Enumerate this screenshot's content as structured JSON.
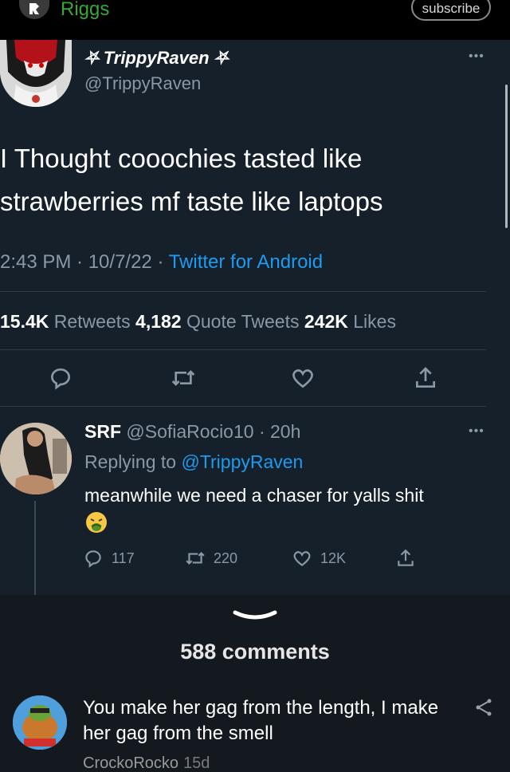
{
  "header": {
    "channel_name": "Riggs",
    "subscribe_label": "subscribe",
    "channel_color": "#36a836"
  },
  "tweet": {
    "display_name": "⛧ TrippyRaven ⛧",
    "handle": "@TrippyRaven",
    "more_label": "•••",
    "text_line1": "I Thought cooochies tasted like",
    "text_line2": "strawberries mf taste like laptops",
    "time_date": "2:43 PM · 10/7/22 · ",
    "source": "Twitter for Android",
    "retweets_count": "15.4K",
    "retweets_label": " Retweets ",
    "quotes_count": "4,182",
    "quotes_label": " Quote Tweets ",
    "likes_count": "242K",
    "likes_label": " Likes",
    "actions": [
      "reply-icon",
      "retweet-icon",
      "like-icon",
      "share-icon"
    ]
  },
  "reply": {
    "name": "SRF",
    "handle_time": " @SofiaRocio10 · 20h",
    "more_label": "•••",
    "replying_prefix": "Replying to ",
    "replying_to": "@TrippyRaven",
    "text": "meanwhile we need a chaser for yalls shit",
    "emoji_icon": "nauseated-face-icon",
    "reply_count": "117",
    "retweet_count": "220",
    "like_count": "12K"
  },
  "comments": {
    "count_label": "588 comments",
    "first": {
      "text": "You make her gag from the length, I make her gag from the smell",
      "author": "CrockoRocko",
      "age": "15d"
    }
  },
  "colors": {
    "tweet_bg": "#15202b",
    "link_blue": "#1d9bf0",
    "muted_gray": "#8b98a5"
  }
}
